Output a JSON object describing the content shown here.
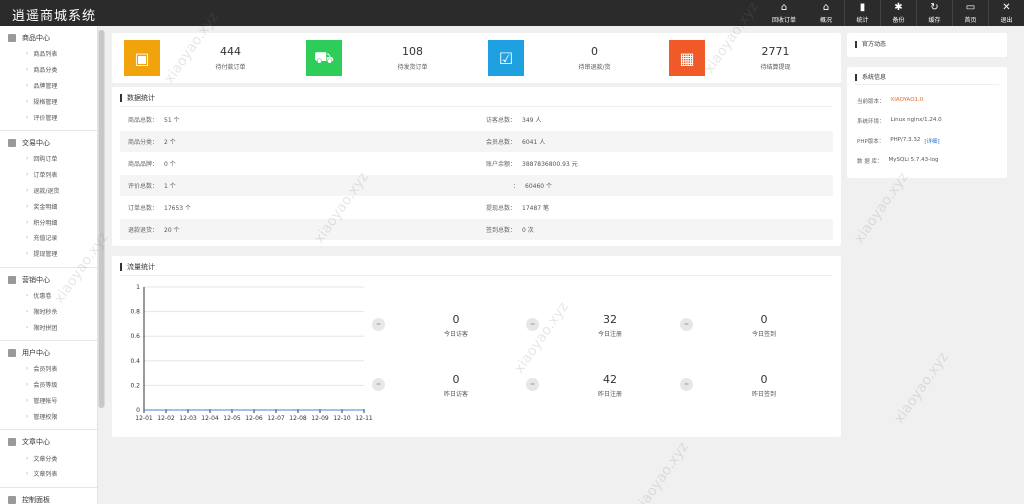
{
  "app": {
    "title": "逍遥商城系统"
  },
  "topnav": [
    {
      "icon": "home-icon",
      "glyph": "⌂",
      "label": "回收订单"
    },
    {
      "icon": "home-icon",
      "glyph": "⌂",
      "label": "概况"
    },
    {
      "icon": "bar-chart-icon",
      "glyph": "▮",
      "label": "统计"
    },
    {
      "icon": "gear-icon",
      "glyph": "✱",
      "label": "备份"
    },
    {
      "icon": "refresh-icon",
      "glyph": "↻",
      "label": "缓存"
    },
    {
      "icon": "monitor-icon",
      "glyph": "▭",
      "label": "首页"
    },
    {
      "icon": "close-icon",
      "glyph": "✕",
      "label": "退出"
    }
  ],
  "sidebar": {
    "groups": [
      {
        "title": "商品中心",
        "items": [
          "商品列表",
          "商品分类",
          "品牌管理",
          "规格管理",
          "评价管理"
        ]
      },
      {
        "title": "交易中心",
        "items": [
          "回购订单",
          "订单列表",
          "退款/退货",
          "奖金明细",
          "积分明细",
          "充值记录",
          "提现管理"
        ]
      },
      {
        "title": "营销中心",
        "items": [
          "优惠卷",
          "限时秒杀",
          "限时拼团"
        ]
      },
      {
        "title": "用户中心",
        "items": [
          "会员列表",
          "会员等级",
          "管理帐号",
          "管理权限"
        ]
      },
      {
        "title": "文章中心",
        "items": [
          "文章分类",
          "文章列表"
        ]
      },
      {
        "title": "控制面板",
        "items": []
      }
    ]
  },
  "stats": [
    {
      "value": "444",
      "label": "待付款订单",
      "color": "#f0a30a",
      "icon": "wallet-icon",
      "glyph": "▣"
    },
    {
      "value": "108",
      "label": "待发货订单",
      "color": "#2ecc58",
      "icon": "truck-icon",
      "glyph": "⛟"
    },
    {
      "value": "0",
      "label": "待审退款/货",
      "color": "#1fa0e0",
      "icon": "check-box-icon",
      "glyph": "☑"
    },
    {
      "value": "2771",
      "label": "待结算提现",
      "color": "#f05a28",
      "icon": "calculator-icon",
      "glyph": "▦"
    }
  ],
  "data_stats": {
    "title": "数据统计",
    "rows": [
      {
        "lk": "商品总数：",
        "lv": "51 个",
        "rk": "访客总数：",
        "rv": "349 人"
      },
      {
        "lk": "商品分类：",
        "lv": "2 个",
        "rk": "会员总数：",
        "rv": "6041 人"
      },
      {
        "lk": "商品品牌：",
        "lv": "0 个",
        "rk": "账户余额：",
        "rv": "3887836800.93 元"
      },
      {
        "lk": "评价总数：",
        "lv": "1 个",
        "rk": "：",
        "rv": "60460 个"
      },
      {
        "lk": "订单总数：",
        "lv": "17653 个",
        "rk": "提现总数：",
        "rv": "17487 笔"
      },
      {
        "lk": "退款退货：",
        "lv": "20 个",
        "rk": "签到总数：",
        "rv": "0 次"
      }
    ]
  },
  "official": {
    "title": "官方动态"
  },
  "system": {
    "title": "系统信息",
    "rows": [
      {
        "k": "当前版本：",
        "v": "XIAOYAO1.0",
        "highlight": true
      },
      {
        "k": "系统环境：",
        "v": "Linux nginx/1.24.0"
      },
      {
        "k": "PHP版本：",
        "v": "PHP/7.3.32",
        "link": "[详细]"
      },
      {
        "k": "数 据 库：",
        "v": "MySQLi 5.7.43-log"
      }
    ],
    "accent": "#e8692a",
    "link_color": "#2a6fd1"
  },
  "flow": {
    "title": "流量统计",
    "cells": [
      {
        "value": "0",
        "label": "今日访客"
      },
      {
        "value": "32",
        "label": "今日注册"
      },
      {
        "value": "0",
        "label": "今日签到"
      },
      {
        "value": "0",
        "label": "昨日访客"
      },
      {
        "value": "42",
        "label": "昨日注册"
      },
      {
        "value": "0",
        "label": "昨日签到"
      }
    ],
    "dot_glyph": "="
  },
  "chart_data": {
    "type": "line",
    "x": [
      "12-01",
      "12-02",
      "12-03",
      "12-04",
      "12-05",
      "12-06",
      "12-07",
      "12-08",
      "12-09",
      "12-10",
      "12-11"
    ],
    "series": [
      {
        "values": [
          0,
          0,
          0,
          0,
          0,
          0,
          0,
          0,
          0,
          0,
          0
        ]
      }
    ],
    "ylim": [
      0,
      1
    ],
    "yticks": [
      "0",
      "0.2",
      "0.4",
      "0.6",
      "0.8",
      "1"
    ],
    "grid": true,
    "title": "",
    "xlabel": "",
    "ylabel": "",
    "line_color": "#4a7fd6"
  },
  "watermark_text": "xiaoyao.xyz"
}
